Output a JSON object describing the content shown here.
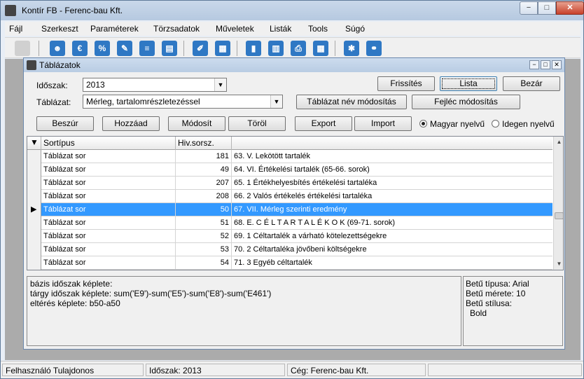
{
  "app": {
    "title": "Kontír FB  - Ferenc-bau Kft.",
    "window_buttons": {
      "minimize": "−",
      "maximize": "□",
      "close": "✕"
    }
  },
  "menu": [
    "Fájl",
    "Szerkeszt",
    "Paraméterek",
    "Törzsadatok",
    "Műveletek",
    "Listák",
    "Tools",
    "Súgó"
  ],
  "toolbar_icons": [
    "open-icon",
    "user-icon",
    "euro-icon",
    "percent-icon",
    "wrench-icon",
    "document-icon",
    "clipboard-icon",
    "edit-icon",
    "calculator-icon",
    "chart-icon",
    "report-icon",
    "print-icon",
    "table-icon",
    "settings-icon",
    "link-icon"
  ],
  "child": {
    "title": "Táblázatok",
    "idoszak_label": "Időszak:",
    "idoszak_value": "2013",
    "tablazat_label": "Táblázat:",
    "tablazat_value": "Mérleg, tartalomrészletezéssel",
    "buttons": {
      "frissites": "Frissítés",
      "lista": "Lista",
      "bezar": "Bezár",
      "tabla_nev": "Táblázat név módosítás",
      "fejlec": "Fejléc módosítás",
      "beszur": "Beszúr",
      "hozzaad": "Hozzáad",
      "modosit": "Módosít",
      "torol": "Töröl",
      "export": "Export",
      "import": "Import"
    },
    "radio_magyar": "Magyar nyelvű",
    "radio_idegen": "Idegen nyelvű",
    "grid": {
      "columns": [
        "Sortípus",
        "Hiv.sorsz.",
        ""
      ],
      "rows": [
        {
          "type": "Táblázat sor",
          "num": "181",
          "text": "63.  V. Lekötött tartalék"
        },
        {
          "type": "Táblázat sor",
          "num": "49",
          "text": "64.  VI. Értékelési tartalék (65-66. sorok)"
        },
        {
          "type": "Táblázat sor",
          "num": "207",
          "text": "65.      1 Értékhelyesbítés értékelési tartaléka"
        },
        {
          "type": "Táblázat sor",
          "num": "208",
          "text": "66.      2 Valós értékelés értékelési tartaléka"
        },
        {
          "type": "Táblázat sor",
          "num": "50",
          "text": "67.  VII. Mérleg szerinti eredmény"
        },
        {
          "type": "Táblázat sor",
          "num": "51",
          "text": "68. E. C É L T A R T A L É K O K    (69-71. sorok)"
        },
        {
          "type": "Táblázat sor",
          "num": "52",
          "text": "69.      1 Céltartalék a várható kötelezettségekre"
        },
        {
          "type": "Táblázat sor",
          "num": "53",
          "text": "70.      2 Céltartaléka jövőbeni költségekre"
        },
        {
          "type": "Táblázat sor",
          "num": "54",
          "text": "71.      3 Egyéb céltartalék"
        }
      ],
      "selected_index": 4
    },
    "info": {
      "line1": "bázis időszak képlete:",
      "line2": "tárgy időszak képlete: sum('E9')-sum('E5')-sum('E8')-sum('E461')",
      "line3": "eltérés képlete: b50-a50"
    },
    "font": {
      "type": "Betű típusa: Arial",
      "size": "Betű mérete: 10",
      "style_label": "Betű stílusa:",
      "style_value": "Bold"
    }
  },
  "status": {
    "user": "Felhasználó Tulajdonos",
    "period": "Időszak: 2013",
    "company": "Cég: Ferenc-bau Kft."
  }
}
